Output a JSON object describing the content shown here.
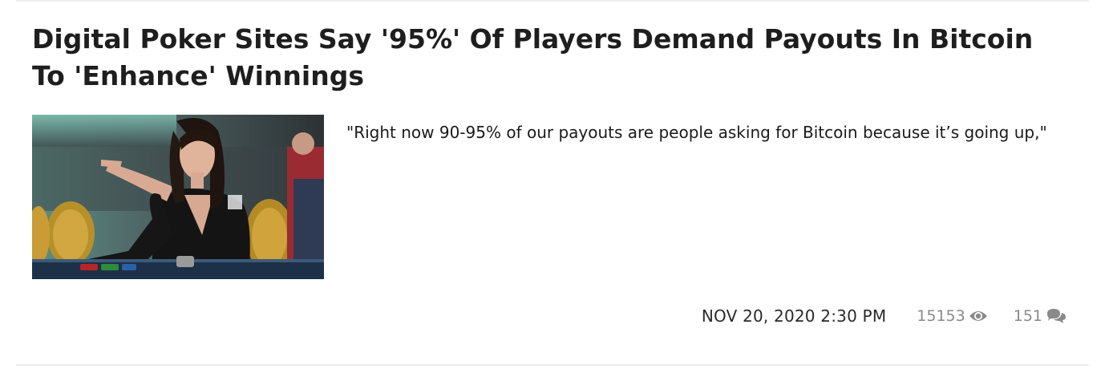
{
  "article": {
    "title": "Digital Poker Sites Say '95%' Of Players Demand Payouts In Bitcoin To 'Enhance' Winnings",
    "excerpt": "\"Right now 90-95% of our payouts are people asking for Bitcoin because it’s going up,\"",
    "date": "NOV 20, 2020 2:30 PM",
    "views": "15153",
    "comments": "151",
    "thumbnail_subject": "woman at poker table pointing",
    "view_icon": "eye-icon",
    "comment_icon": "comments-icon"
  },
  "colors": {
    "title": "#1e1e1e",
    "meta": "#8a8a8a",
    "divider": "#eeeeee"
  }
}
